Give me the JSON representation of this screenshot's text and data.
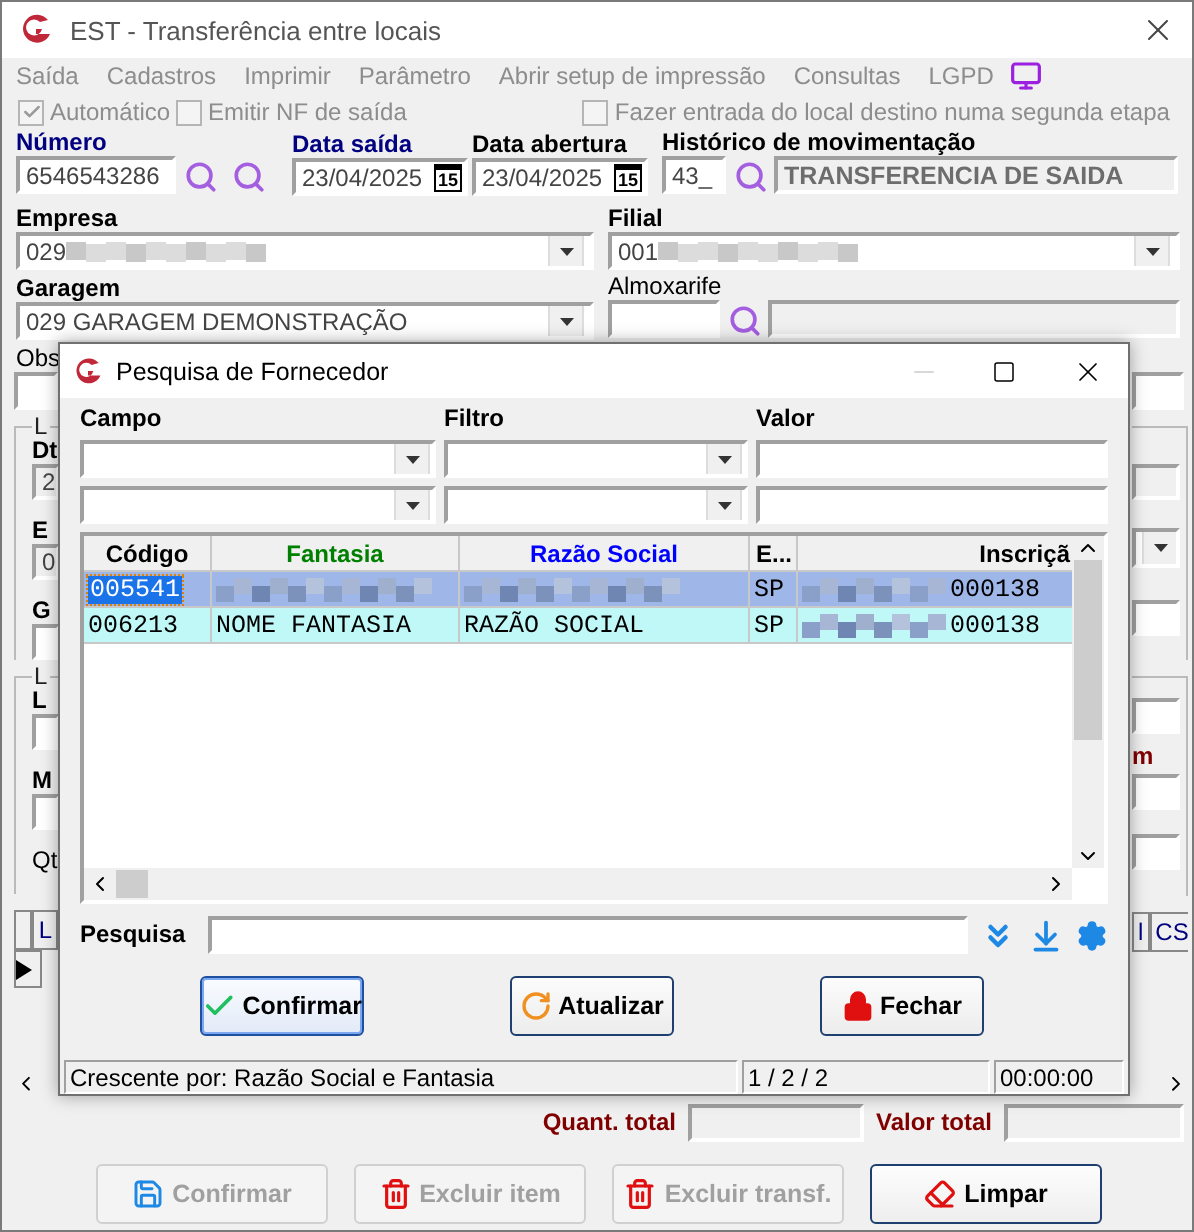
{
  "window": {
    "title": "EST - Transferência entre locais"
  },
  "menu": [
    {
      "label": "Saída"
    },
    {
      "label": "Cadastros"
    },
    {
      "label": "Imprimir"
    },
    {
      "label": "Parâmetro"
    },
    {
      "label": "Abrir setup de impressão"
    },
    {
      "label": "Consultas"
    },
    {
      "label": "LGPD"
    }
  ],
  "options": [
    {
      "label": "Automático",
      "checked": true,
      "disabled": true
    },
    {
      "label": "Emitir NF de saída",
      "checked": false,
      "disabled": true
    },
    {
      "label": "Fazer entrada do local destino numa segunda etapa",
      "checked": false,
      "disabled": true
    }
  ],
  "numero": {
    "label": "Número",
    "required": true,
    "value": "6546543286"
  },
  "data_saida": {
    "label": "Data saída",
    "required": true,
    "value": "23/04/2025",
    "day_badge": "15"
  },
  "data_abertura": {
    "label": "Data abertura",
    "required": false,
    "value": "23/04/2025",
    "day_badge": "15"
  },
  "historico": {
    "label": "Histórico de movimentação",
    "required": false,
    "code": "43_",
    "description": "TRANSFERENCIA DE SAIDA"
  },
  "empresa": {
    "label": "Empresa",
    "value": "029"
  },
  "filial": {
    "label": "Filial",
    "value": "001"
  },
  "garagem": {
    "label": "Garagem",
    "value": "029 GARAGEM DEMONSTRAÇÃO"
  },
  "almoxarife": {
    "label": "Almoxarife"
  },
  "obs_label": "Obs",
  "behind": {
    "left": {
      "group_1": "L",
      "dt": "Dt",
      "dt_value": "2",
      "em": "E",
      "em_value": "0",
      "ga": "G",
      "group_2": "L",
      "lo": "L",
      "m": "M",
      "qt": "Qt",
      "grid_col": "L"
    },
    "right": {
      "m": "m",
      "grid_cols": [
        "l",
        "CS"
      ]
    }
  },
  "dialog": {
    "title": "Pesquisa de Fornecedor",
    "filter_labels": [
      "Campo",
      "Filtro",
      "Valor"
    ],
    "columns": [
      {
        "label": "Código",
        "color": "#000000"
      },
      {
        "label": "Fantasia",
        "color": "#008000"
      },
      {
        "label": "Razão Social",
        "color": "#0000ff"
      },
      {
        "label": "E...",
        "color": "#000000"
      },
      {
        "label": "Inscriçã",
        "color": "#000000"
      }
    ],
    "rows": [
      {
        "selected": true,
        "cells": [
          {
            "kind": "text",
            "text": "005541"
          },
          {
            "kind": "redacted"
          },
          {
            "kind": "redacted"
          },
          {
            "kind": "text",
            "text": "SP"
          },
          {
            "kind": "redacted",
            "text": "000138"
          }
        ]
      },
      {
        "selected": false,
        "cells": [
          {
            "kind": "text",
            "text": "006213"
          },
          {
            "kind": "text",
            "text": "NOME FANTASIA"
          },
          {
            "kind": "text",
            "text": "RAZÃO SOCIAL"
          },
          {
            "kind": "text",
            "text": "SP"
          },
          {
            "kind": "redacted",
            "text": "000138"
          }
        ]
      }
    ],
    "search_label": "Pesquisa",
    "buttons": [
      {
        "label": "Confirmar",
        "kind": "confirm",
        "default": true
      },
      {
        "label": "Atualizar",
        "kind": "refresh",
        "default": false
      },
      {
        "label": "Fechar",
        "kind": "close",
        "default": false
      }
    ],
    "status": [
      "Crescente por: Razão Social e Fantasia",
      "1 / 2 / 2",
      "00:00:00"
    ]
  },
  "totals": [
    {
      "label": "Quant. total"
    },
    {
      "label": "Valor total"
    }
  ],
  "buttons": [
    {
      "label": "Confirmar",
      "kind": "save",
      "disabled": true
    },
    {
      "label": "Excluir item",
      "kind": "delete",
      "disabled": true
    },
    {
      "label": "Excluir transf.",
      "kind": "delete",
      "disabled": true
    },
    {
      "label": "Limpar",
      "kind": "clear",
      "disabled": false
    }
  ]
}
